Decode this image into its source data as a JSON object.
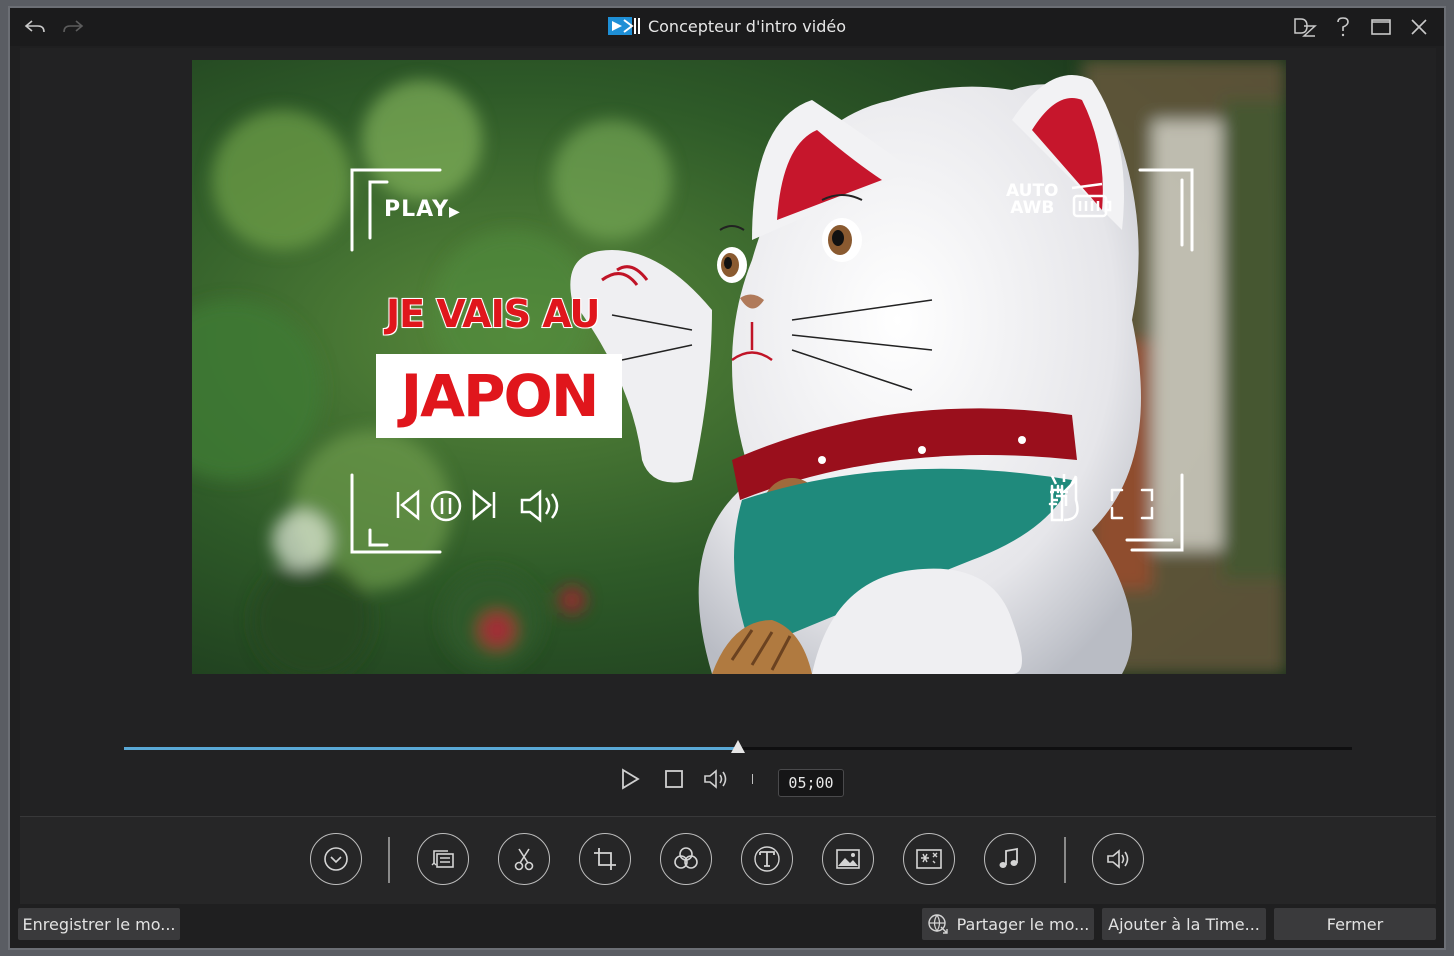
{
  "window": {
    "title": "Concepteur d'intro vidéo",
    "accent": "#5aa9d6"
  },
  "titlebar_icons": [
    "undo-icon",
    "redo-icon",
    "dz-icon",
    "help-icon",
    "maximize-icon",
    "close-icon"
  ],
  "preview": {
    "headline_line1": "JE VAIS AU",
    "headline_line2": "JAPON",
    "camera_play": "PLAY",
    "camera_auto": "AUTO",
    "camera_awb": "AWB",
    "text_color": "#e0161c"
  },
  "playback": {
    "progress_fraction": 0.5,
    "timecode": "05;00"
  },
  "tools": [
    {
      "name": "duration-icon"
    },
    {
      "name": "replace-media-icon"
    },
    {
      "name": "trim-icon"
    },
    {
      "name": "crop-icon"
    },
    {
      "name": "color-adjust-icon"
    },
    {
      "name": "title-text-icon"
    },
    {
      "name": "image-overlay-icon"
    },
    {
      "name": "effects-icon"
    },
    {
      "name": "music-icon"
    },
    {
      "name": "volume-icon"
    }
  ],
  "footer": {
    "save_template": "Enregistrer le mo...",
    "share_template": "Partager le mo...",
    "add_timeline": "Ajouter à la Time...",
    "close": "Fermer"
  }
}
